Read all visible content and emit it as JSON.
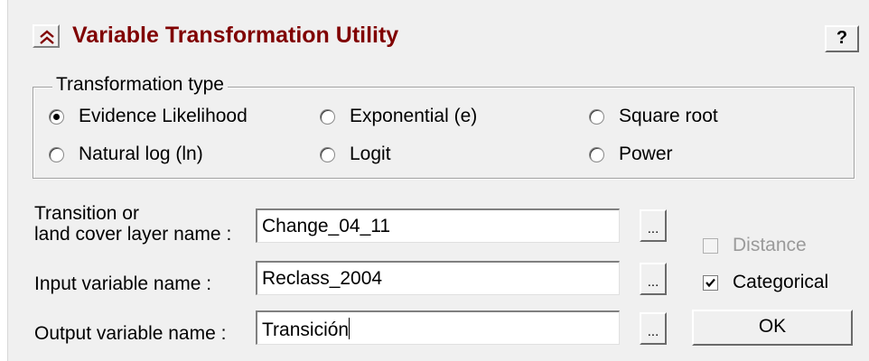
{
  "header": {
    "title": "Variable Transformation Utility",
    "help_label": "?"
  },
  "transformation": {
    "legend": "Transformation type",
    "options": [
      {
        "label": "Evidence Likelihood",
        "selected": true
      },
      {
        "label": "Exponential (e)",
        "selected": false
      },
      {
        "label": "Square root",
        "selected": false
      },
      {
        "label": "Natural log (ln)",
        "selected": false
      },
      {
        "label": "Logit",
        "selected": false
      },
      {
        "label": "Power",
        "selected": false
      }
    ]
  },
  "fields": {
    "transition": {
      "label_line1": "Transition or",
      "label_line2": "land cover layer name :",
      "value": "Change_04_11"
    },
    "input": {
      "label": "Input variable name :",
      "value": "Reclass_2004"
    },
    "output": {
      "label": "Output variable name :",
      "value": "Transición"
    },
    "browse_label": "..."
  },
  "options": {
    "distance": {
      "label": "Distance",
      "checked": false,
      "enabled": false
    },
    "categorical": {
      "label": "Categorical",
      "checked": true,
      "enabled": true
    }
  },
  "ok_label": "OK"
}
